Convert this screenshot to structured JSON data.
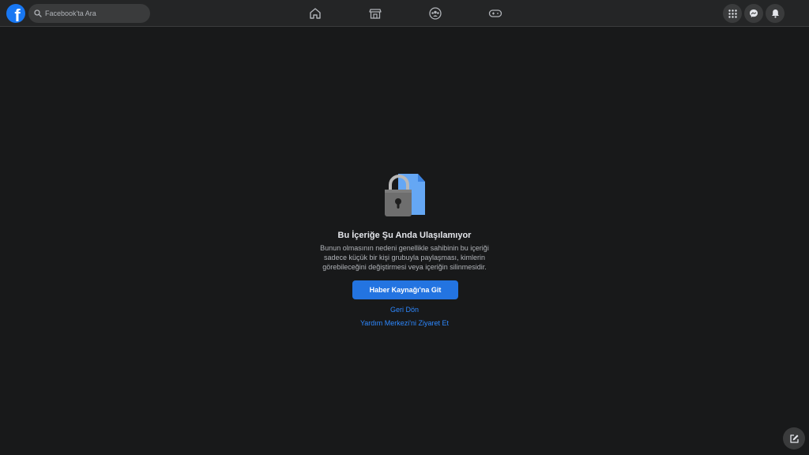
{
  "header": {
    "logo_letter": "f",
    "search_placeholder": "Facebook'ta Ara",
    "nav": [
      "home-icon",
      "marketplace-icon",
      "groups-icon",
      "gaming-icon"
    ],
    "right": [
      "menu-grid-icon",
      "messenger-icon",
      "notifications-bell-icon"
    ]
  },
  "main": {
    "title": "Bu İçeriğe Şu Anda Ulaşılamıyor",
    "description": "Bunun olmasının nedeni genellikle sahibinin bu içeriği sadece küçük bir kişi grubuyla paylaşması, kimlerin görebileceğini değiştirmesi veya içeriğin silinmesidir.",
    "primary_button": "Haber Kaynağı'na Git",
    "back_link": "Geri Dön",
    "help_link": "Yardım Merkezi'ni Ziyaret Et"
  },
  "colors": {
    "background": "#18191a",
    "topbar": "#242526",
    "accent": "#2374e1",
    "link": "#2d88ff"
  }
}
